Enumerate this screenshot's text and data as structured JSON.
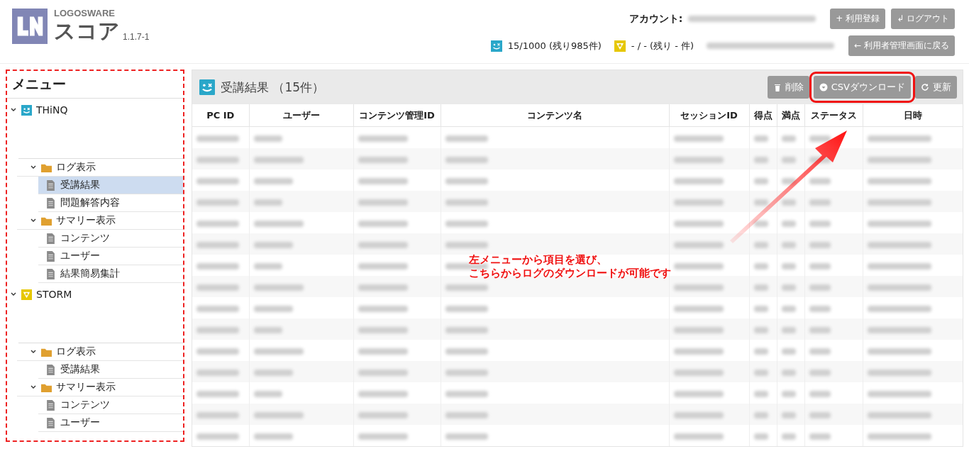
{
  "header": {
    "brand": "LOGOSWARE",
    "product": "スコア",
    "version": "1.1.7-1",
    "account_label": "アカウント:",
    "buttons": [
      "+ 利用登録",
      "↲ ログアウト"
    ],
    "quotas": [
      {
        "kind": "thinq",
        "text": "15/1000 (残り985件)"
      },
      {
        "kind": "storm",
        "text": "- / - (残り - 件)"
      }
    ],
    "back_button": "← 利用者管理画面に戻る"
  },
  "sidebar": {
    "title": "メニュー",
    "items": [
      {
        "kind": "thinq",
        "label": "THiNQ",
        "expanded": true,
        "children": [
          {
            "kind": "folder",
            "label": "ログ表示",
            "expanded": true,
            "children": [
              {
                "kind": "file",
                "label": "受講結果",
                "selected": true
              },
              {
                "kind": "file",
                "label": "問題解答内容",
                "selected": false
              }
            ]
          },
          {
            "kind": "folder",
            "label": "サマリー表示",
            "expanded": true,
            "children": [
              {
                "kind": "file",
                "label": "コンテンツ",
                "selected": false
              },
              {
                "kind": "file",
                "label": "ユーザー",
                "selected": false
              },
              {
                "kind": "file",
                "label": "結果簡易集計",
                "selected": false
              }
            ]
          }
        ]
      },
      {
        "kind": "storm",
        "label": "STORM",
        "expanded": true,
        "children": [
          {
            "kind": "folder",
            "label": "ログ表示",
            "expanded": true,
            "children": [
              {
                "kind": "file",
                "label": "受講結果",
                "selected": false
              }
            ]
          },
          {
            "kind": "folder",
            "label": "サマリー表示",
            "expanded": true,
            "children": [
              {
                "kind": "file",
                "label": "コンテンツ",
                "selected": false
              },
              {
                "kind": "file",
                "label": "ユーザー",
                "selected": false
              }
            ]
          }
        ]
      }
    ]
  },
  "panel": {
    "title": "受講結果 （15件）",
    "buttons": [
      {
        "kind": "delete",
        "label": "削除",
        "highlighted": false
      },
      {
        "kind": "download",
        "label": "CSVダウンロード",
        "highlighted": true
      },
      {
        "kind": "refresh",
        "label": "更新",
        "highlighted": false
      }
    ],
    "table": {
      "columns": [
        "PC ID",
        "ユーザー",
        "コンテンツ管理ID",
        "コンテンツ名",
        "セッションID",
        "得点",
        "満点",
        "ステータス",
        "日時"
      ],
      "rows": [
        {
          "kind": "blurred"
        },
        {
          "kind": "blurred"
        },
        {
          "kind": "blurred"
        },
        {
          "kind": "blurred"
        },
        {
          "kind": "blurred"
        },
        {
          "kind": "blurred"
        },
        {
          "kind": "blurred"
        },
        {
          "kind": "blurred"
        },
        {
          "kind": "blurred"
        },
        {
          "kind": "blurred"
        },
        {
          "kind": "blurred"
        },
        {
          "kind": "blurred"
        },
        {
          "kind": "blurred"
        },
        {
          "kind": "blurred"
        },
        {
          "kind": "blurred"
        }
      ]
    }
  },
  "annotation": {
    "lines": [
      "左メニューから項目を選び、",
      "こちらからログのダウンロードが可能です"
    ]
  }
}
